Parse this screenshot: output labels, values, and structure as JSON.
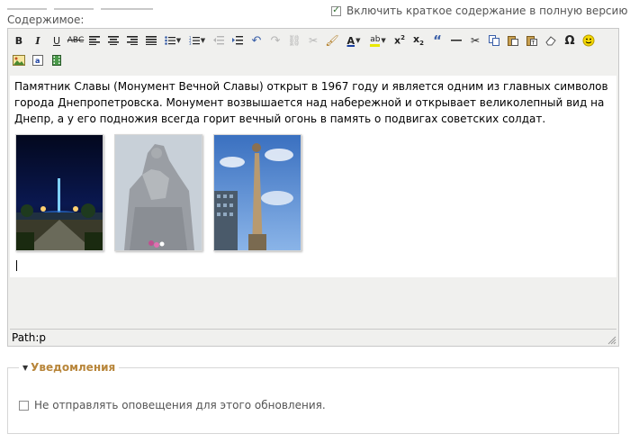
{
  "form": {
    "content_label": "Содержимое:",
    "summary_checkbox_label": "Включить краткое содержание в полную версию",
    "summary_checked": true
  },
  "editor": {
    "toolbar_icons": [
      "bold-icon",
      "italic-icon",
      "underline-icon",
      "strikethrough-icon",
      "align-left-icon",
      "align-center-icon",
      "align-right-icon",
      "align-justify-icon",
      "bullet-list-icon",
      "numbered-list-icon",
      "outdent-icon",
      "indent-icon",
      "undo-icon",
      "redo-icon",
      "link-icon",
      "unlink-icon",
      "cleanup-icon",
      "text-color-icon",
      "highlight-color-icon",
      "superscript-icon",
      "subscript-icon",
      "blockquote-icon",
      "horizontal-rule-icon",
      "cut-icon",
      "copy-icon",
      "paste-icon",
      "paste-text-icon",
      "paste-word-icon",
      "erase-icon",
      "special-char-icon",
      "emoticon-icon",
      "insert-image-icon",
      "insert-anchor-icon",
      "insert-media-icon"
    ],
    "body_text": "Памятник Славы (Монумент Вечной Славы) открыт в 1967 году и является одним из главных символов города Днепропетровска. Монумент возвышается над набережной и открывает великолепный вид на Днепр, а у его подножия всегда горит вечный огонь в память о подвигах советских солдат.",
    "path_label": "Path: ",
    "path_value": "p"
  },
  "notifications": {
    "legend": "Уведомления",
    "checkbox_label": "Не отправлять оповещения для этого обновления.",
    "checked": false
  },
  "colors": {
    "legend_accent": "#b8863b",
    "checkbox_check": "#2f6e2f"
  }
}
